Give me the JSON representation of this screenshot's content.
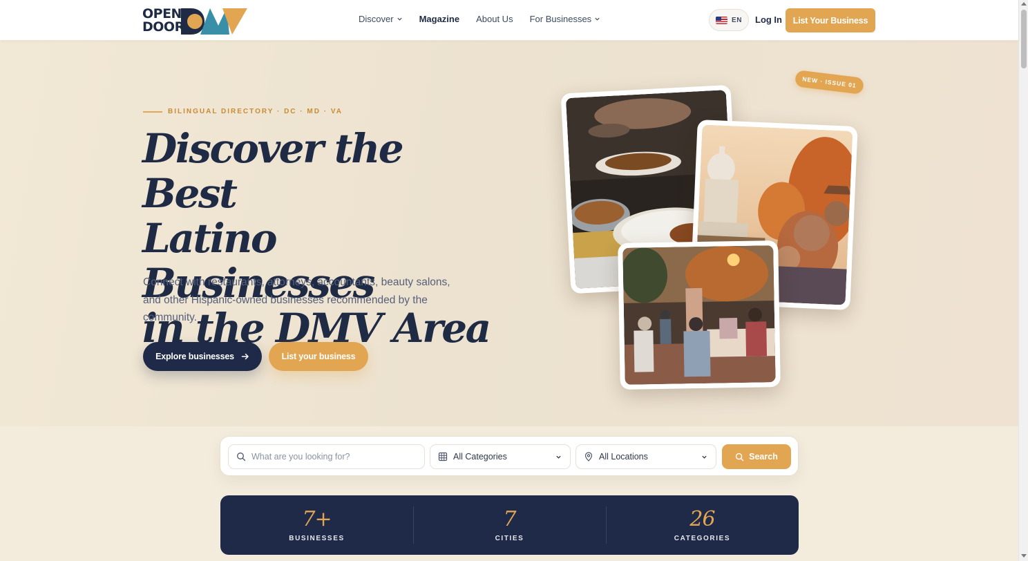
{
  "header": {
    "logo": {
      "line1": "OPEN",
      "line2": "DOOR",
      "mark": "DMV"
    },
    "nav": [
      {
        "label": "Discover",
        "has_dropdown": true
      },
      {
        "label": "Magazine",
        "has_dropdown": false,
        "active": true
      },
      {
        "label": "About Us",
        "has_dropdown": false
      },
      {
        "label": "For Businesses",
        "has_dropdown": true
      }
    ],
    "language": "EN",
    "login_label": "Log In",
    "list_business_label": "List Your Business"
  },
  "hero": {
    "eyebrow": "BILINGUAL DIRECTORY · DC · MD · VA",
    "headline": [
      "Discover the Best",
      "Latino Businesses",
      "in the DMV Area"
    ],
    "subtitle": "Connect with restaurants, attorneys, accountants, beauty salons, and other Hispanic-owned businesses recommended by the community.",
    "explore_label": "Explore businesses",
    "list_label": "List your business",
    "badge": "NEW · ISSUE 01"
  },
  "search": {
    "placeholder": "What are you looking for?",
    "category": "All Categories",
    "location": "All Locations",
    "button": "Search"
  },
  "stats": [
    {
      "value": "7+",
      "label": "BUSINESSES"
    },
    {
      "value": "7",
      "label": "CITIES"
    },
    {
      "value": "26",
      "label": "CATEGORIES"
    }
  ],
  "colors": {
    "navy": "#1f2a48",
    "gold": "#e2a653",
    "cream": "#f3ebdc",
    "teal": "#3a8fa8"
  }
}
